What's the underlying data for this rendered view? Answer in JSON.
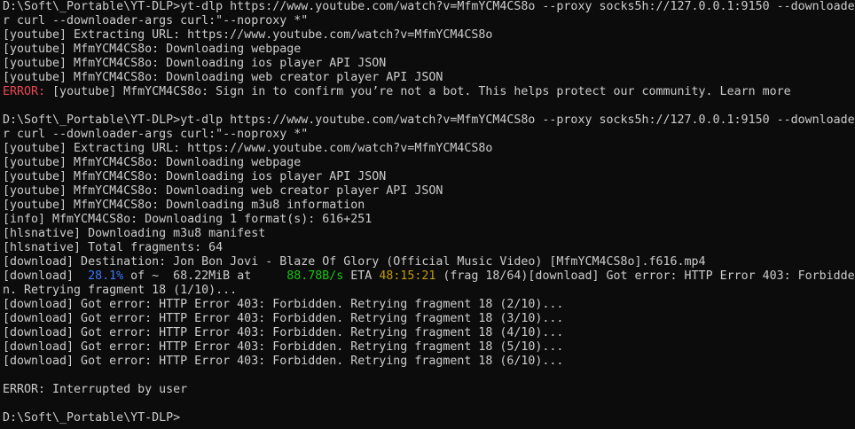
{
  "colors": {
    "background": "#0c0c0c",
    "text": "#cccccc",
    "error": "#e74856",
    "percent": "#3b78ff",
    "speed": "#16c60c",
    "eta": "#c19c00"
  },
  "terminal": {
    "lines": [
      "D:\\Soft\\_Portable\\YT-DLP>yt-dlp https://www.youtube.com/watch?v=MfmYCM4CS8o --proxy socks5h://127.0.0.1:9150 --downloade",
      "r curl --downloader-args curl:\"--noproxy *\"",
      "[youtube] Extracting URL: https://www.youtube.com/watch?v=MfmYCM4CS8o",
      "[youtube] MfmYCM4CS8o: Downloading webpage",
      "[youtube] MfmYCM4CS8o: Downloading ios player API JSON",
      "[youtube] MfmYCM4CS8o: Downloading web creator player API JSON",
      {
        "error_label": "ERROR:",
        "rest": " [youtube] MfmYCM4CS8o: Sign in to confirm you’re not a bot. This helps protect our community. Learn more"
      },
      "",
      "D:\\Soft\\_Portable\\YT-DLP>yt-dlp https://www.youtube.com/watch?v=MfmYCM4CS8o --proxy socks5h://127.0.0.1:9150 --downloade",
      "r curl --downloader-args curl:\"--noproxy *\"",
      "[youtube] Extracting URL: https://www.youtube.com/watch?v=MfmYCM4CS8o",
      "[youtube] MfmYCM4CS8o: Downloading webpage",
      "[youtube] MfmYCM4CS8o: Downloading ios player API JSON",
      "[youtube] MfmYCM4CS8o: Downloading web creator player API JSON",
      "[youtube] MfmYCM4CS8o: Downloading m3u8 information",
      "[info] MfmYCM4CS8o: Downloading 1 format(s): 616+251",
      "[hlsnative] Downloading m3u8 manifest",
      "[hlsnative] Total fragments: 64",
      "[download] Destination: Jon Bon Jovi - Blaze Of Glory (Official Music Video) [MfmYCM4CS8o].f616.mp4",
      {
        "prefix": "[download]  ",
        "percent": "28.1%",
        "mid1": " of ~  68.22MiB at     ",
        "speed": "88.78B/s",
        "mid2": " ETA ",
        "eta": "48:15:21",
        "rest": " (frag 18/64)[download] Got error: HTTP Error 403: Forbidde"
      },
      "n. Retrying fragment 18 (1/10)...",
      "[download] Got error: HTTP Error 403: Forbidden. Retrying fragment 18 (2/10)...",
      "[download] Got error: HTTP Error 403: Forbidden. Retrying fragment 18 (3/10)...",
      "[download] Got error: HTTP Error 403: Forbidden. Retrying fragment 18 (4/10)...",
      "[download] Got error: HTTP Error 403: Forbidden. Retrying fragment 18 (5/10)...",
      "[download] Got error: HTTP Error 403: Forbidden. Retrying fragment 18 (6/10)...",
      "",
      "ERROR: Interrupted by user",
      "",
      "D:\\Soft\\_Portable\\YT-DLP>"
    ]
  }
}
